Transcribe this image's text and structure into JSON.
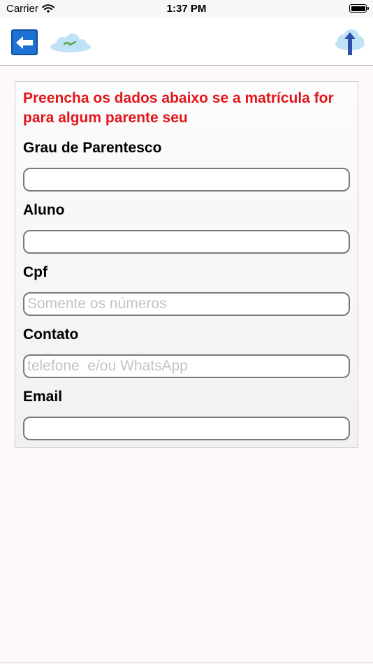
{
  "status_bar": {
    "carrier": "Carrier",
    "time": "1:37 PM",
    "icons": [
      "wifi-icon",
      "battery-icon"
    ]
  },
  "nav_bar": {
    "back_icon": "arrow-left-icon",
    "logo_icon": "cloud-logo-icon",
    "upload_icon": "cloud-upload-icon"
  },
  "form": {
    "notice": "Preencha os dados abaixo se a matrícula for para algum parente seu",
    "fields": [
      {
        "label": "Grau de Parentesco",
        "value": "",
        "placeholder": ""
      },
      {
        "label": "Aluno",
        "value": "",
        "placeholder": ""
      },
      {
        "label": "Cpf",
        "value": "",
        "placeholder": "Somente os números"
      },
      {
        "label": "Contato",
        "value": "",
        "placeholder": "telefone  e/ou WhatsApp"
      },
      {
        "label": "Email",
        "value": "",
        "placeholder": ""
      }
    ]
  },
  "colors": {
    "notice_text": "#e3161b",
    "back_button": "#1c72d3",
    "upload_arrow": "#2f4fa8",
    "cloud": "#bfe3f6",
    "input_border": "#7a7a7a",
    "placeholder": "#c4c4c4",
    "page_background": "#fdf9f8"
  }
}
